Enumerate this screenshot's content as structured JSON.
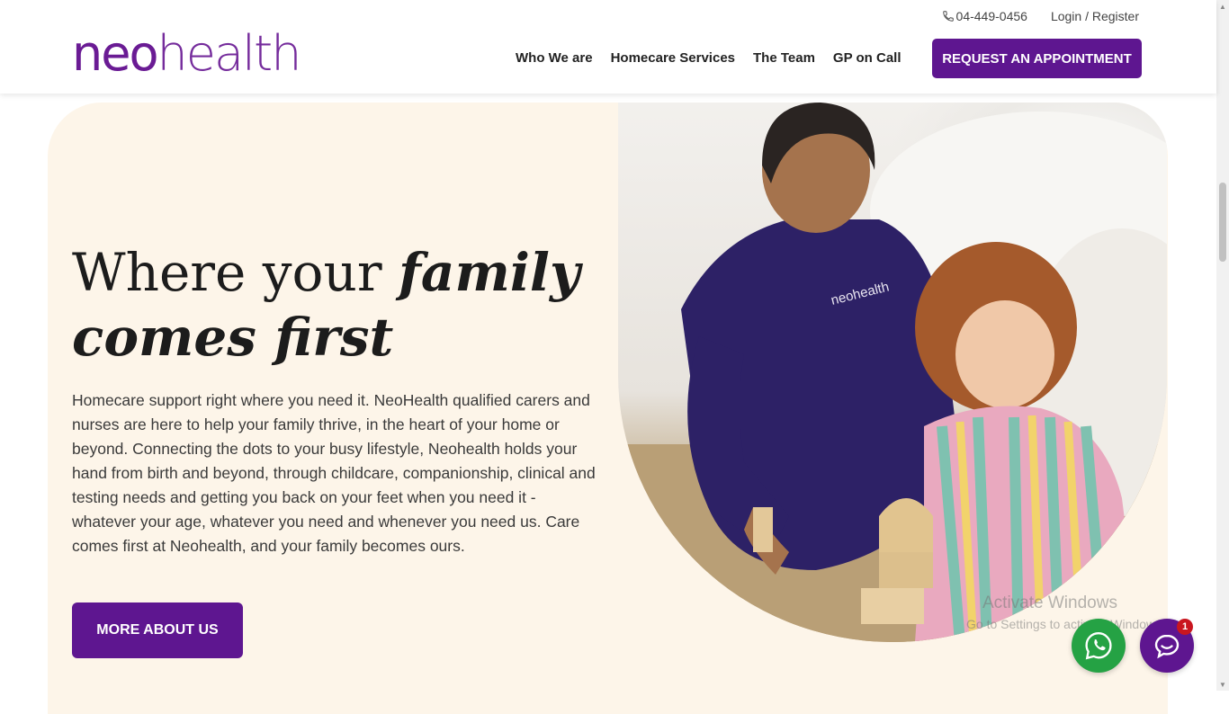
{
  "header": {
    "phone": "04-449-0456",
    "login_label": "Login / Register",
    "logo_neo": "neo",
    "logo_health": "health",
    "nav": [
      "Who We are",
      "Homecare Services",
      "The Team",
      "GP on Call"
    ],
    "cta_label": "REQUEST AN APPOINTMENT"
  },
  "hero": {
    "headline_plain": "Where your ",
    "headline_italic_1": "family",
    "headline_italic_2": "comes first",
    "body": "Homecare support right where you need it. NeoHealth qualified carers and nurses are here to help your family thrive, in the heart of your home or beyond. Connecting the dots to your busy lifestyle, Neohealth holds your hand from birth and beyond, through childcare, companionship, clinical and testing needs and getting you back on your feet when you need it - whatever your age, whatever you need and whenever you need us. Care comes first at Neohealth, and your family becomes ours.",
    "button_label": "MORE ABOUT US",
    "photo_scrub_logo": "neohealth"
  },
  "watermark": {
    "line1": "Activate Windows",
    "line2": "Go to Settings to activate Windows."
  },
  "chat": {
    "badge_count": "1"
  },
  "colors": {
    "brand_purple": "#5e1690",
    "hero_bg": "#fdf5e9",
    "whatsapp_green": "#25a244"
  }
}
